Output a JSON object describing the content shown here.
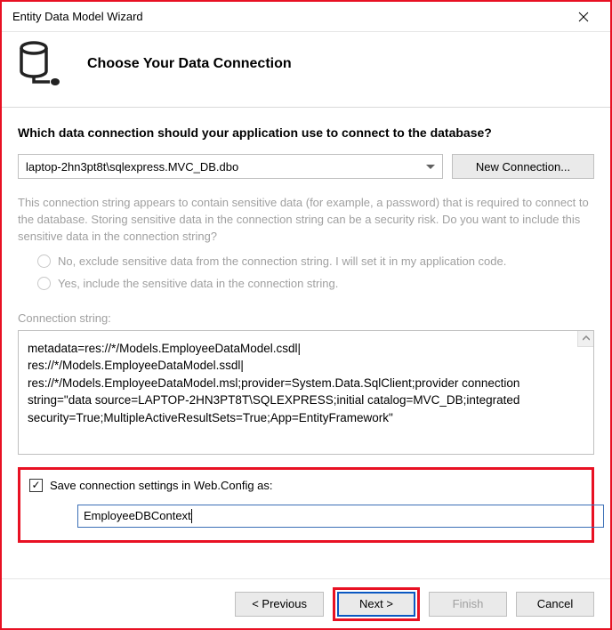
{
  "window": {
    "title": "Entity Data Model Wizard"
  },
  "header": {
    "title": "Choose Your Data Connection"
  },
  "question": "Which data connection should your application use to connect to the database?",
  "connection": {
    "selected": "laptop-2hn3pt8t\\sqlexpress.MVC_DB.dbo",
    "new_button": "New Connection..."
  },
  "sensitive_info": "This connection string appears to contain sensitive data (for example, a password) that is required to connect to the database. Storing sensitive data in the connection string can be a security risk. Do you want to include this sensitive data in the connection string?",
  "radios": {
    "exclude": "No, exclude sensitive data from the connection string. I will set it in my application code.",
    "include": "Yes, include the sensitive data in the connection string."
  },
  "conn_label": "Connection string:",
  "conn_value": "metadata=res://*/Models.EmployeeDataModel.csdl|\nres://*/Models.EmployeeDataModel.ssdl|\nres://*/Models.EmployeeDataModel.msl;provider=System.Data.SqlClient;provider connection string=\"data source=LAPTOP-2HN3PT8T\\SQLEXPRESS;initial catalog=MVC_DB;integrated security=True;MultipleActiveResultSets=True;App=EntityFramework\"",
  "save": {
    "checkbox_label": "Save connection settings in Web.Config as:",
    "checked": true,
    "value": "EmployeeDBContext"
  },
  "buttons": {
    "previous": "< Previous",
    "next": "Next >",
    "finish": "Finish",
    "cancel": "Cancel"
  }
}
